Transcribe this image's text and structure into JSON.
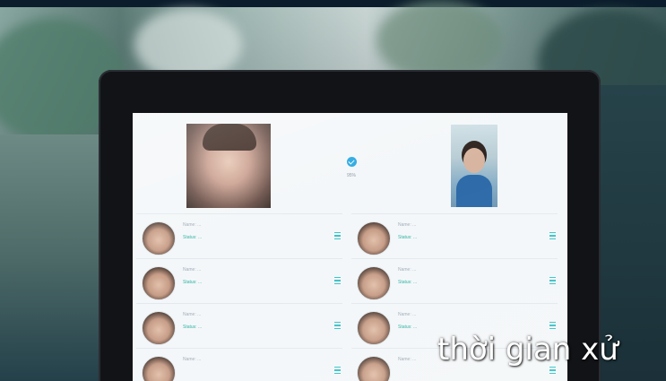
{
  "screen": {
    "match_label": "95%"
  },
  "left_list": [
    {
      "title": "Name: ...",
      "status": "Status: ..."
    },
    {
      "title": "Name: ...",
      "status": "Status: ..."
    },
    {
      "title": "Name: ...",
      "status": "Status: ..."
    },
    {
      "title": "Name: ...",
      "status": ""
    }
  ],
  "right_list": [
    {
      "title": "Name: ...",
      "status": "Status: ..."
    },
    {
      "title": "Name: ...",
      "status": "Status: ..."
    },
    {
      "title": "Name: ...",
      "status": "Status: ..."
    },
    {
      "title": "Name: ...",
      "status": ""
    }
  ],
  "caption": "thời gian xử",
  "icons": {
    "match": "check-icon",
    "row_menu": "menu-icon"
  },
  "colors": {
    "accent": "#29a8e0",
    "status_text": "#2fb3a5",
    "menu": "#3cc3c8"
  }
}
